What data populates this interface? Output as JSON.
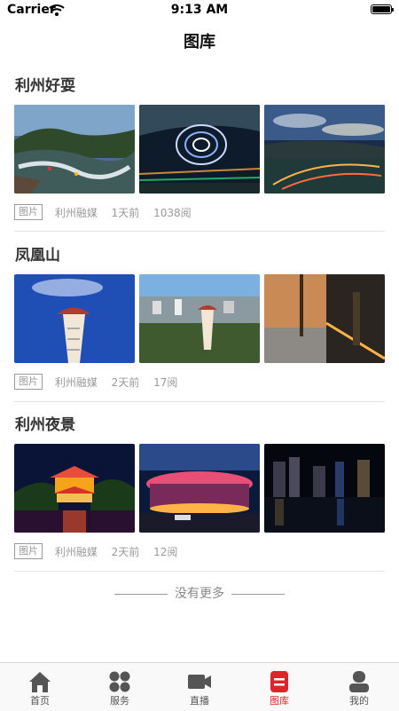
{
  "status_bar": {
    "carrier": "Carrier",
    "time": "9:13 AM"
  },
  "nav": {
    "title": "图库"
  },
  "albums": [
    {
      "title": "利州好耍",
      "tag": "图片",
      "source": "利州融媒",
      "time": "1天前",
      "views": "1038阅",
      "images": [
        "rafting-river-photo",
        "water-light-show-photo",
        "sunset-lake-lights-photo"
      ]
    },
    {
      "title": "凤凰山",
      "tag": "图片",
      "source": "利州融媒",
      "time": "2天前",
      "views": "17阅",
      "images": [
        "phoenix-tower-photo",
        "city-overlook-photo",
        "park-night-walkway-photo"
      ]
    },
    {
      "title": "利州夜景",
      "tag": "图片",
      "source": "利州融媒",
      "time": "2天前",
      "views": "12阅",
      "images": [
        "pavilion-night-photo",
        "stadium-night-photo",
        "city-skyline-night-photo"
      ]
    }
  ],
  "footer": {
    "no_more": "没有更多"
  },
  "tabbar": {
    "active": "图库",
    "accent": "#e0232a",
    "items": [
      {
        "label": "首页",
        "icon": "home-icon"
      },
      {
        "label": "服务",
        "icon": "services-grid-icon"
      },
      {
        "label": "直播",
        "icon": "video-camera-icon"
      },
      {
        "label": "图库",
        "icon": "gallery-icon"
      },
      {
        "label": "我的",
        "icon": "profile-icon"
      }
    ]
  }
}
